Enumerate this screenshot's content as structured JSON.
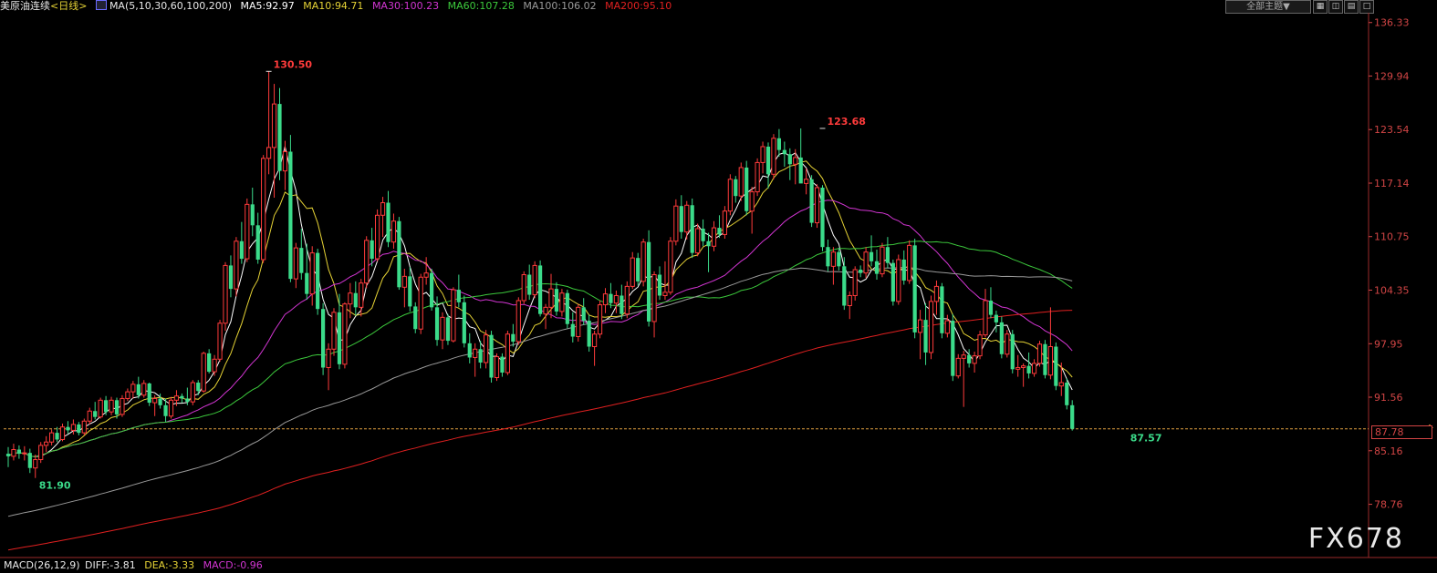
{
  "header": {
    "symbol": "美原油连续",
    "period": "<日线>",
    "ma_params": "MA(5,10,30,60,100,200)",
    "ma5": "MA5:92.97",
    "ma10": "MA10:94.71",
    "ma30": "MA30:100.23",
    "ma60": "MA60:107.28",
    "ma100": "MA100:106.02",
    "ma200": "MA200:95.10",
    "theme_button": "全部主题▼"
  },
  "colors": {
    "up": "#ff3b3b",
    "down": "#3bdb8a",
    "ma5": "#ffffff",
    "ma10": "#e6d335",
    "ma30": "#d235d2",
    "ma60": "#3cc93c",
    "ma100": "#9a9a9a",
    "ma200": "#e02020",
    "axis": "#d24545",
    "last_line": "#e0a040"
  },
  "macd": {
    "label": "MACD(26,12,9)",
    "diff": "DIFF:-3.81",
    "dea": "DEA:-3.33",
    "macd": "MACD:-0.96"
  },
  "watermark": "FX678",
  "last_price_box": "87.78",
  "chart_data": {
    "type": "candlestick",
    "y_axis_ticks": [
      "136.33",
      "129.94",
      "123.54",
      "117.14",
      "110.75",
      "104.35",
      "97.95",
      "91.56",
      "85.16",
      "78.76"
    ],
    "ylim": [
      72.4,
      137.5
    ],
    "last_price": 87.78,
    "annotations": [
      {
        "label": "130.50",
        "value": 130.5,
        "bar": 48,
        "kind": "high"
      },
      {
        "label": "123.68",
        "value": 123.68,
        "bar": 150,
        "kind": "high"
      },
      {
        "label": "81.90",
        "value": 81.9,
        "bar": 5,
        "kind": "low"
      },
      {
        "label": "87.57",
        "value": 87.57,
        "bar": 206,
        "kind": "low"
      }
    ],
    "ohlc": [
      [
        84.8,
        85.6,
        83.2,
        84.5
      ],
      [
        84.5,
        86.0,
        84.0,
        85.3
      ],
      [
        85.3,
        85.8,
        84.2,
        84.8
      ],
      [
        84.8,
        85.7,
        84.0,
        84.9
      ],
      [
        84.9,
        85.4,
        82.5,
        83.1
      ],
      [
        83.1,
        84.7,
        81.9,
        84.1
      ],
      [
        84.1,
        86.2,
        83.7,
        85.8
      ],
      [
        85.8,
        86.9,
        85.0,
        86.2
      ],
      [
        86.2,
        87.7,
        85.8,
        87.3
      ],
      [
        87.3,
        88.0,
        86.2,
        86.5
      ],
      [
        86.5,
        88.4,
        86.3,
        88.0
      ],
      [
        88.0,
        88.7,
        87.2,
        87.6
      ],
      [
        87.6,
        88.9,
        87.1,
        88.3
      ],
      [
        88.3,
        88.6,
        87.0,
        87.3
      ],
      [
        87.3,
        89.0,
        87.0,
        88.7
      ],
      [
        88.7,
        90.3,
        88.3,
        89.9
      ],
      [
        89.9,
        91.0,
        88.9,
        89.2
      ],
      [
        89.2,
        91.5,
        89.0,
        91.2
      ],
      [
        91.2,
        91.7,
        89.4,
        89.8
      ],
      [
        89.8,
        91.6,
        89.4,
        91.2
      ],
      [
        91.2,
        91.5,
        89.0,
        89.5
      ],
      [
        89.5,
        91.8,
        89.2,
        91.4
      ],
      [
        91.4,
        92.6,
        91.1,
        92.2
      ],
      [
        92.2,
        93.5,
        91.4,
        93.1
      ],
      [
        93.1,
        94.0,
        91.4,
        91.8
      ],
      [
        91.8,
        93.6,
        91.5,
        93.2
      ],
      [
        93.2,
        93.3,
        90.5,
        90.9
      ],
      [
        90.9,
        91.8,
        89.3,
        91.4
      ],
      [
        91.4,
        92.0,
        90.2,
        90.6
      ],
      [
        90.6,
        91.4,
        88.6,
        89.3
      ],
      [
        89.3,
        91.6,
        89.0,
        91.2
      ],
      [
        91.2,
        92.4,
        90.5,
        91.7
      ],
      [
        91.7,
        92.0,
        90.9,
        91.4
      ],
      [
        91.4,
        92.7,
        90.6,
        91.0
      ],
      [
        91.0,
        93.6,
        90.6,
        93.3
      ],
      [
        93.3,
        93.6,
        91.8,
        92.3
      ],
      [
        92.3,
        97.0,
        92.1,
        96.8
      ],
      [
        96.8,
        97.3,
        94.4,
        94.6
      ],
      [
        94.6,
        96.6,
        94.1,
        96.1
      ],
      [
        96.1,
        100.8,
        95.8,
        100.4
      ],
      [
        100.4,
        107.7,
        99.5,
        107.3
      ],
      [
        107.3,
        108.5,
        103.5,
        104.5
      ],
      [
        104.5,
        110.7,
        103.6,
        110.2
      ],
      [
        110.2,
        112.5,
        107.5,
        108.1
      ],
      [
        108.1,
        115.3,
        107.7,
        114.6
      ],
      [
        114.6,
        116.6,
        110.8,
        112.1
      ],
      [
        112.1,
        113.6,
        107.5,
        108.0
      ],
      [
        108.0,
        120.5,
        107.6,
        120.1
      ],
      [
        120.1,
        130.5,
        118.2,
        121.4
      ],
      [
        121.4,
        129.0,
        115.4,
        126.6
      ],
      [
        126.6,
        128.5,
        117.5,
        118.6
      ],
      [
        118.6,
        122.2,
        116.3,
        120.9
      ],
      [
        120.9,
        122.9,
        105.3,
        105.7
      ],
      [
        105.7,
        110.0,
        104.6,
        109.4
      ],
      [
        109.4,
        111.7,
        105.6,
        106.4
      ],
      [
        106.4,
        109.9,
        103.2,
        103.9
      ],
      [
        103.9,
        109.6,
        102.5,
        108.8
      ],
      [
        108.8,
        109.3,
        101.4,
        102.1
      ],
      [
        102.1,
        102.8,
        94.2,
        95.1
      ],
      [
        95.1,
        98.0,
        92.4,
        97.3
      ],
      [
        97.3,
        102.2,
        96.5,
        101.7
      ],
      [
        101.7,
        103.9,
        94.9,
        95.5
      ],
      [
        95.5,
        102.9,
        95.0,
        102.7
      ],
      [
        102.7,
        105.2,
        101.0,
        104.0
      ],
      [
        104.0,
        105.4,
        101.3,
        102.3
      ],
      [
        102.3,
        105.7,
        101.2,
        105.2
      ],
      [
        105.2,
        110.8,
        104.6,
        110.3
      ],
      [
        110.3,
        111.8,
        107.2,
        108.1
      ],
      [
        108.1,
        114.0,
        107.8,
        113.3
      ],
      [
        113.3,
        115.5,
        110.7,
        114.8
      ],
      [
        114.8,
        116.2,
        109.5,
        110.1
      ],
      [
        110.1,
        113.5,
        109.3,
        112.6
      ],
      [
        112.6,
        113.1,
        104.4,
        104.7
      ],
      [
        104.7,
        106.9,
        102.3,
        106.0
      ],
      [
        106.0,
        107.1,
        101.8,
        102.4
      ],
      [
        102.4,
        102.9,
        99.2,
        99.7
      ],
      [
        99.7,
        106.3,
        99.1,
        105.9
      ],
      [
        105.9,
        108.3,
        105.0,
        106.4
      ],
      [
        106.4,
        106.9,
        101.9,
        102.3
      ],
      [
        102.3,
        103.6,
        97.7,
        98.4
      ],
      [
        98.4,
        101.7,
        97.3,
        101.1
      ],
      [
        101.1,
        101.5,
        97.8,
        98.3
      ],
      [
        98.3,
        104.7,
        98.1,
        104.4
      ],
      [
        104.4,
        106.2,
        102.3,
        102.9
      ],
      [
        102.9,
        103.7,
        97.5,
        98.0
      ],
      [
        98.0,
        99.2,
        95.6,
        96.3
      ],
      [
        96.3,
        98.0,
        94.0,
        97.3
      ],
      [
        97.3,
        98.3,
        95.0,
        95.7
      ],
      [
        95.7,
        99.6,
        95.0,
        99.0
      ],
      [
        99.0,
        99.5,
        93.3,
        93.9
      ],
      [
        93.9,
        96.8,
        93.5,
        96.4
      ],
      [
        96.4,
        96.8,
        94.0,
        94.5
      ],
      [
        94.5,
        99.5,
        94.2,
        99.1
      ],
      [
        99.1,
        100.3,
        97.6,
        98.2
      ],
      [
        98.2,
        103.5,
        97.8,
        103.1
      ],
      [
        103.1,
        106.6,
        102.7,
        106.2
      ],
      [
        106.2,
        107.4,
        103.2,
        103.8
      ],
      [
        103.8,
        107.8,
        103.4,
        107.3
      ],
      [
        107.3,
        107.9,
        101.2,
        101.5
      ],
      [
        101.5,
        102.7,
        99.7,
        102.3
      ],
      [
        102.3,
        106.3,
        101.0,
        104.5
      ],
      [
        104.5,
        105.3,
        101.3,
        101.8
      ],
      [
        101.8,
        104.5,
        101.2,
        104.0
      ],
      [
        104.0,
        104.4,
        99.8,
        100.3
      ],
      [
        100.3,
        101.7,
        98.1,
        98.8
      ],
      [
        98.8,
        102.7,
        98.2,
        102.3
      ],
      [
        102.3,
        103.4,
        100.2,
        100.7
      ],
      [
        100.7,
        101.4,
        97.0,
        97.6
      ],
      [
        97.6,
        99.5,
        95.3,
        99.1
      ],
      [
        99.1,
        103.1,
        98.6,
        102.6
      ],
      [
        102.6,
        104.6,
        101.6,
        103.9
      ],
      [
        103.9,
        105.2,
        102.2,
        102.8
      ],
      [
        102.8,
        104.3,
        101.6,
        103.7
      ],
      [
        103.7,
        105.0,
        100.9,
        101.5
      ],
      [
        101.5,
        105.4,
        101.0,
        104.8
      ],
      [
        104.8,
        108.9,
        104.5,
        108.2
      ],
      [
        108.2,
        108.8,
        104.9,
        105.4
      ],
      [
        105.4,
        110.5,
        104.8,
        110.1
      ],
      [
        110.1,
        111.5,
        100.0,
        100.6
      ],
      [
        100.6,
        106.6,
        98.7,
        106.2
      ],
      [
        106.2,
        107.2,
        103.2,
        103.7
      ],
      [
        103.7,
        107.8,
        103.2,
        104.1
      ],
      [
        104.1,
        110.7,
        103.8,
        110.2
      ],
      [
        110.2,
        115.2,
        109.7,
        114.4
      ],
      [
        114.4,
        115.7,
        110.5,
        111.3
      ],
      [
        111.3,
        115.0,
        110.4,
        114.5
      ],
      [
        114.5,
        115.3,
        108.2,
        108.8
      ],
      [
        108.8,
        112.3,
        108.4,
        111.7
      ],
      [
        111.7,
        112.8,
        109.6,
        110.2
      ],
      [
        110.2,
        111.2,
        106.5,
        109.6
      ],
      [
        109.6,
        112.6,
        109.0,
        111.8
      ],
      [
        111.8,
        113.3,
        110.6,
        111.0
      ],
      [
        111.0,
        114.4,
        110.5,
        113.8
      ],
      [
        113.8,
        118.2,
        113.3,
        117.6
      ],
      [
        117.6,
        118.0,
        114.8,
        115.6
      ],
      [
        115.6,
        119.6,
        115.0,
        119.0
      ],
      [
        119.0,
        119.8,
        113.3,
        113.8
      ],
      [
        113.8,
        116.7,
        111.1,
        116.1
      ],
      [
        116.1,
        120.1,
        115.6,
        119.6
      ],
      [
        119.6,
        122.1,
        118.3,
        121.5
      ],
      [
        121.5,
        122.0,
        116.5,
        118.2
      ],
      [
        118.2,
        123.0,
        117.6,
        122.5
      ],
      [
        122.5,
        123.6,
        120.3,
        121.1
      ],
      [
        121.1,
        122.1,
        119.1,
        120.6
      ],
      [
        120.6,
        121.3,
        117.5,
        119.4
      ],
      [
        119.4,
        121.2,
        117.0,
        120.2
      ],
      [
        120.2,
        123.68,
        119.5,
        117.1
      ],
      [
        117.1,
        118.9,
        115.8,
        117.6
      ],
      [
        117.6,
        118.1,
        111.9,
        112.4
      ],
      [
        112.4,
        117.0,
        111.8,
        116.6
      ],
      [
        116.6,
        116.9,
        109.0,
        109.5
      ],
      [
        109.5,
        110.4,
        106.6,
        107.2
      ],
      [
        107.2,
        109.5,
        105.0,
        108.9
      ],
      [
        108.9,
        109.4,
        106.7,
        107.2
      ],
      [
        107.2,
        108.3,
        102.0,
        102.5
      ],
      [
        102.5,
        104.2,
        100.9,
        103.7
      ],
      [
        103.7,
        107.2,
        103.1,
        106.8
      ],
      [
        106.8,
        107.3,
        105.9,
        106.4
      ],
      [
        106.4,
        109.5,
        105.8,
        108.9
      ],
      [
        108.9,
        110.9,
        107.2,
        107.8
      ],
      [
        107.8,
        109.2,
        105.6,
        106.3
      ],
      [
        106.3,
        110.0,
        105.9,
        109.5
      ],
      [
        109.5,
        110.7,
        107.0,
        107.6
      ],
      [
        107.6,
        108.0,
        102.5,
        103.0
      ],
      [
        103.0,
        108.6,
        102.6,
        108.0
      ],
      [
        108.0,
        109.1,
        105.0,
        105.5
      ],
      [
        105.5,
        110.3,
        105.1,
        109.7
      ],
      [
        109.7,
        110.5,
        98.6,
        99.3
      ],
      [
        99.3,
        102.0,
        96.1,
        100.8
      ],
      [
        100.8,
        102.8,
        95.4,
        96.9
      ],
      [
        96.9,
        103.7,
        96.1,
        103.0
      ],
      [
        103.0,
        105.5,
        101.4,
        104.8
      ],
      [
        104.8,
        105.2,
        98.6,
        99.2
      ],
      [
        99.2,
        101.4,
        98.7,
        100.7
      ],
      [
        100.7,
        101.5,
        93.5,
        94.1
      ],
      [
        94.1,
        96.7,
        93.8,
        96.2
      ],
      [
        96.2,
        97.1,
        90.4,
        96.6
      ],
      [
        96.6,
        97.3,
        95.1,
        95.6
      ],
      [
        95.6,
        97.0,
        94.5,
        96.5
      ],
      [
        96.5,
        99.5,
        96.1,
        99.0
      ],
      [
        99.0,
        104.5,
        98.7,
        103.1
      ],
      [
        103.1,
        104.7,
        101.0,
        101.4
      ],
      [
        101.4,
        101.9,
        99.3,
        100.5
      ],
      [
        100.5,
        101.2,
        96.2,
        96.7
      ],
      [
        96.7,
        99.6,
        96.3,
        99.1
      ],
      [
        99.1,
        99.6,
        94.4,
        94.9
      ],
      [
        94.9,
        96.6,
        94.0,
        95.1
      ],
      [
        95.1,
        95.6,
        92.8,
        95.3
      ],
      [
        95.3,
        96.9,
        93.8,
        94.4
      ],
      [
        94.4,
        96.1,
        94.0,
        95.6
      ],
      [
        95.6,
        98.3,
        95.2,
        97.9
      ],
      [
        97.9,
        98.4,
        93.8,
        94.2
      ],
      [
        94.2,
        102.3,
        93.7,
        97.6
      ],
      [
        97.6,
        98.1,
        92.4,
        92.9
      ],
      [
        92.9,
        95.7,
        91.7,
        93.3
      ],
      [
        93.3,
        93.8,
        90.1,
        90.6
      ],
      [
        90.6,
        91.2,
        87.57,
        87.78
      ]
    ]
  }
}
